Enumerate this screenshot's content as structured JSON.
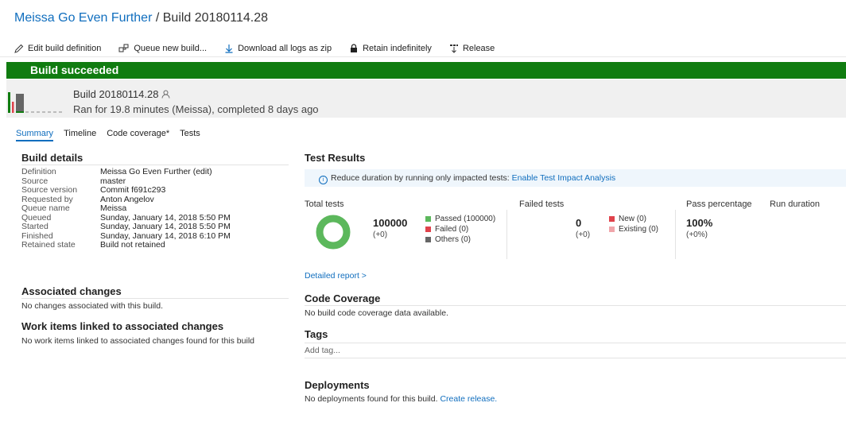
{
  "breadcrumb": {
    "project": "Meissa Go Even Further",
    "separator": " / ",
    "build": "Build 20180114.28"
  },
  "toolbar": {
    "edit": "Edit build definition",
    "queue": "Queue new build...",
    "download": "Download all logs as zip",
    "retain": "Retain indefinitely",
    "release": "Release"
  },
  "status": {
    "text": "Build succeeded",
    "color": "#107c10"
  },
  "build": {
    "name": "Build 20180114.28",
    "ran": "Ran for 19.8 minutes (Meissa), completed 8 days ago"
  },
  "tabs": [
    "Summary",
    "Timeline",
    "Code coverage*",
    "Tests"
  ],
  "details": {
    "title": "Build details",
    "rows": [
      {
        "k": "Definition",
        "v": "Meissa Go Even Further (edit)"
      },
      {
        "k": "Source",
        "v": "master"
      },
      {
        "k": "Source version",
        "v": "Commit f691c293"
      },
      {
        "k": "Requested by",
        "v": "Anton Angelov"
      },
      {
        "k": "Queue name",
        "v": "Meissa"
      },
      {
        "k": "Queued",
        "v": "Sunday, January 14, 2018 5:50 PM"
      },
      {
        "k": "Started",
        "v": "Sunday, January 14, 2018 5:50 PM"
      },
      {
        "k": "Finished",
        "v": "Sunday, January 14, 2018 6:10 PM"
      },
      {
        "k": "Retained state",
        "v": "Build not retained"
      }
    ]
  },
  "assoc": {
    "title": "Associated changes",
    "text": "No changes associated with this build."
  },
  "workitems": {
    "title": "Work items linked to associated changes",
    "text": "No work items linked to associated changes found for this build"
  },
  "tests": {
    "title": "Test Results",
    "info": "Reduce duration by running only impacted tests:",
    "info_link": "Enable Test Impact Analysis",
    "total_label": "Total tests",
    "total": "100000",
    "total_delta": "(+0)",
    "passed": "Passed (100000)",
    "failed": "Failed (0)",
    "others": "Others (0)",
    "failed_label": "Failed tests",
    "failed_count": "0",
    "failed_delta": "(+0)",
    "new": "New (0)",
    "existing": "Existing (0)",
    "pass_label": "Pass percentage",
    "pass_value": "100%",
    "pass_delta": "(+0%)",
    "duration_label": "Run duration",
    "detailed": "Detailed report >",
    "pass_fraction": 1.0,
    "colors": {
      "passed": "#5cb85c",
      "failed": "#e0424b",
      "others": "#666666",
      "new": "#e0424b",
      "existing": "#f0a5aa"
    }
  },
  "coverage": {
    "title": "Code Coverage",
    "text": "No build code coverage data available."
  },
  "tags": {
    "title": "Tags",
    "add": "Add tag..."
  },
  "deployments": {
    "title": "Deployments",
    "text": "No deployments found for this build.",
    "link": "Create release."
  }
}
